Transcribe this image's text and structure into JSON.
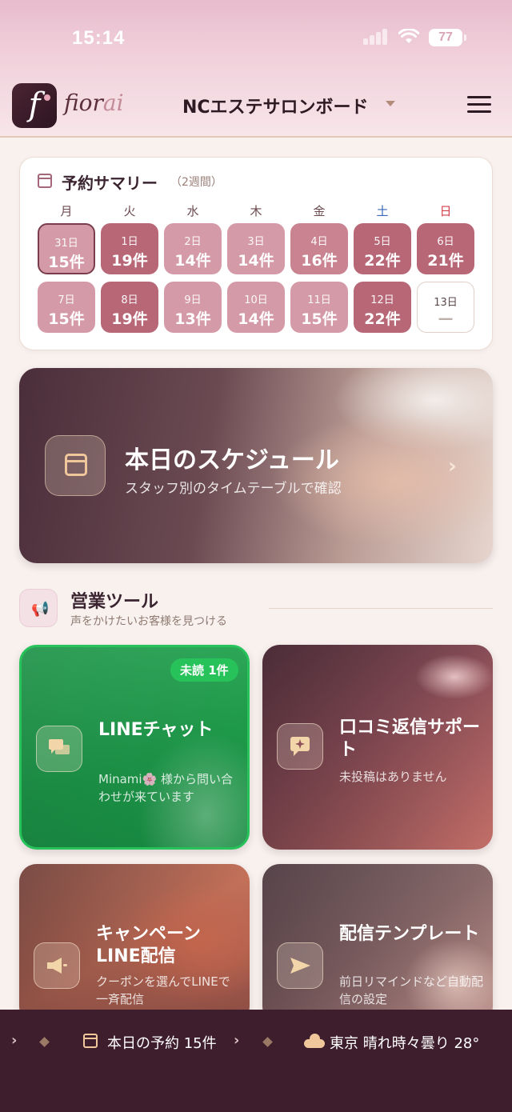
{
  "status_bar": {
    "time": "15:14",
    "battery": "77"
  },
  "header": {
    "logo_mark": "f",
    "logo_text_main": "fior",
    "logo_text_accent": "ai",
    "store_name": "NCエステサロンボード",
    "icons": {
      "store_caret": "caret-down-icon",
      "menu": "hamburger-menu-icon"
    }
  },
  "summary": {
    "title": "予約サマリー",
    "subtitle": "（2週間）",
    "weekdays": [
      "月",
      "火",
      "水",
      "木",
      "金",
      "土",
      "日"
    ],
    "weeks": [
      [
        {
          "date": "31日",
          "count": "15件",
          "level": "lo",
          "selected": true
        },
        {
          "date": "1日",
          "count": "19件",
          "level": "hi"
        },
        {
          "date": "2日",
          "count": "14件",
          "level": "lo"
        },
        {
          "date": "3日",
          "count": "14件",
          "level": "lo"
        },
        {
          "date": "4日",
          "count": "16件",
          "level": "md"
        },
        {
          "date": "5日",
          "count": "22件",
          "level": "hi"
        },
        {
          "date": "6日",
          "count": "21件",
          "level": "hi"
        }
      ],
      [
        {
          "date": "7日",
          "count": "15件",
          "level": "lo"
        },
        {
          "date": "8日",
          "count": "19件",
          "level": "hi"
        },
        {
          "date": "9日",
          "count": "13件",
          "level": "lo"
        },
        {
          "date": "10日",
          "count": "14件",
          "level": "lo"
        },
        {
          "date": "11日",
          "count": "15件",
          "level": "lo"
        },
        {
          "date": "12日",
          "count": "22件",
          "level": "hi"
        },
        {
          "date": "13日",
          "count": "—",
          "level": "empty"
        }
      ]
    ]
  },
  "schedule": {
    "title": "本日のスケジュール",
    "subtitle": "スタッフ別のタイムテーブルで確認",
    "icon": "calendar-icon"
  },
  "tools": {
    "title": "営業ツール",
    "subtitle": "声をかけたいお客様を見つける",
    "icon": "megaphone-icon"
  },
  "tiles": {
    "line_chat": {
      "title": "LINEチャット",
      "subtitle": "Minami🌸 様から問い合わせが来ています",
      "badge": "未読 1件",
      "icon": "chat-bubbles-icon"
    },
    "review": {
      "title": "口コミ返信サポート",
      "subtitle": "未投稿はありません",
      "icon": "sparkle-message-icon"
    },
    "campaign": {
      "title": "キャンペーンLINE配信",
      "subtitle": "クーポンを選んでLINEで一斉配信",
      "icon": "megaphone-icon"
    },
    "template": {
      "title": "配信テンプレート",
      "subtitle": "前日リマインドなど自動配信の設定",
      "icon": "send-icon"
    }
  },
  "ticker": {
    "today_reservations": "本日の予約 15件",
    "weather": "東京 晴れ時々曇り 28°"
  }
}
